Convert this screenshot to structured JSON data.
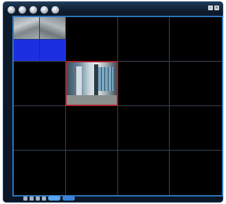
{
  "toolbar": {
    "icons": [
      "camera-icon",
      "record-icon",
      "playback-icon",
      "settings-icon",
      "power-icon"
    ]
  },
  "window_controls": {
    "minimize": "–",
    "close": "×"
  },
  "grid": {
    "layout": "4x4",
    "colors": {
      "frame": "#2f78c0",
      "selected_border": "#b0202a",
      "cell_line": "#3c4854",
      "sub_blue": "#1c2fe0"
    }
  },
  "sub_labels": [
    "",
    ""
  ],
  "bottom_tabs": [
    "",
    ""
  ]
}
